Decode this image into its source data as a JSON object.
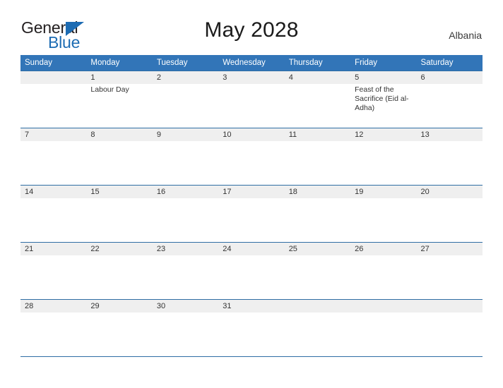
{
  "brand": {
    "name_part1": "General",
    "name_part2": "Blue",
    "triangle_color": "#1d6cb3"
  },
  "header": {
    "title": "May 2028",
    "region": "Albania"
  },
  "colors": {
    "header_blue": "#3275b8",
    "row_border_blue": "#2e6da4",
    "daynum_band": "#efefef",
    "text": "#333333"
  },
  "calendar": {
    "weekday_headers": [
      "Sunday",
      "Monday",
      "Tuesday",
      "Wednesday",
      "Thursday",
      "Friday",
      "Saturday"
    ],
    "weeks": [
      [
        {
          "day": "",
          "events": []
        },
        {
          "day": "1",
          "events": [
            "Labour Day"
          ]
        },
        {
          "day": "2",
          "events": []
        },
        {
          "day": "3",
          "events": []
        },
        {
          "day": "4",
          "events": []
        },
        {
          "day": "5",
          "events": [
            "Feast of the Sacrifice (Eid al-Adha)"
          ]
        },
        {
          "day": "6",
          "events": []
        }
      ],
      [
        {
          "day": "7",
          "events": []
        },
        {
          "day": "8",
          "events": []
        },
        {
          "day": "9",
          "events": []
        },
        {
          "day": "10",
          "events": []
        },
        {
          "day": "11",
          "events": []
        },
        {
          "day": "12",
          "events": []
        },
        {
          "day": "13",
          "events": []
        }
      ],
      [
        {
          "day": "14",
          "events": []
        },
        {
          "day": "15",
          "events": []
        },
        {
          "day": "16",
          "events": []
        },
        {
          "day": "17",
          "events": []
        },
        {
          "day": "18",
          "events": []
        },
        {
          "day": "19",
          "events": []
        },
        {
          "day": "20",
          "events": []
        }
      ],
      [
        {
          "day": "21",
          "events": []
        },
        {
          "day": "22",
          "events": []
        },
        {
          "day": "23",
          "events": []
        },
        {
          "day": "24",
          "events": []
        },
        {
          "day": "25",
          "events": []
        },
        {
          "day": "26",
          "events": []
        },
        {
          "day": "27",
          "events": []
        }
      ],
      [
        {
          "day": "28",
          "events": []
        },
        {
          "day": "29",
          "events": []
        },
        {
          "day": "30",
          "events": []
        },
        {
          "day": "31",
          "events": []
        },
        {
          "day": "",
          "events": []
        },
        {
          "day": "",
          "events": []
        },
        {
          "day": "",
          "events": []
        }
      ]
    ]
  }
}
